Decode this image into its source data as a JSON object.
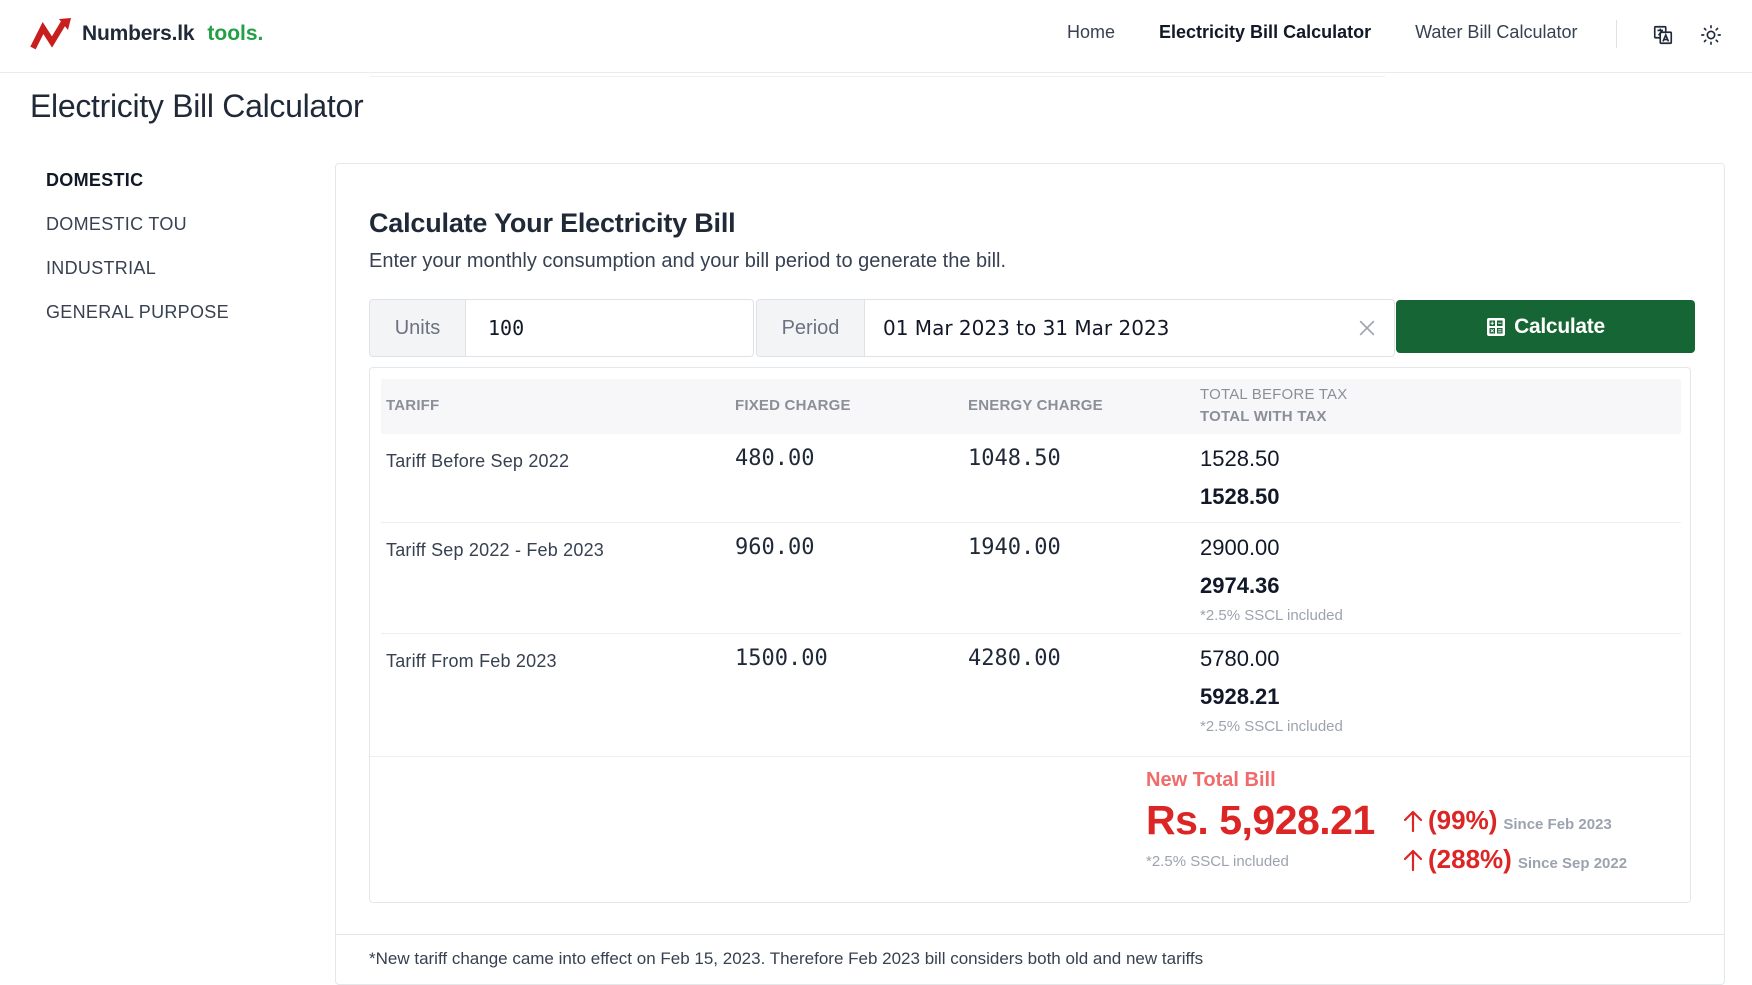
{
  "brand": {
    "name": "Numbers.lk",
    "suffix": "tools."
  },
  "nav": {
    "links": [
      "Home",
      "Electricity Bill Calculator",
      "Water Bill Calculator"
    ],
    "active_index": 1
  },
  "page_title": "Electricity Bill Calculator",
  "sidebar": {
    "items": [
      {
        "label": "DOMESTIC",
        "active": true
      },
      {
        "label": "DOMESTIC TOU",
        "active": false
      },
      {
        "label": "INDUSTRIAL",
        "active": false
      },
      {
        "label": "GENERAL PURPOSE",
        "active": false
      }
    ]
  },
  "card": {
    "title": "Calculate Your Electricity Bill",
    "subtitle": "Enter your monthly consumption and your bill period to generate the bill."
  },
  "form": {
    "units_label": "Units",
    "units_value": "100",
    "period_label": "Period",
    "period_value": "01 Mar 2023 to 31 Mar 2023",
    "calculate_label": "Calculate"
  },
  "table": {
    "headers": {
      "tariff": "TARIFF",
      "fixed": "FIXED CHARGE",
      "energy": "ENERGY CHARGE",
      "total_before": "TOTAL BEFORE TAX",
      "total_with": "TOTAL WITH TAX"
    },
    "rows": [
      {
        "tariff": "Tariff Before Sep 2022",
        "fixed": "480.00",
        "energy": "1048.50",
        "total_before": "1528.50",
        "total_with": "1528.50",
        "note": ""
      },
      {
        "tariff": "Tariff Sep 2022 - Feb 2023",
        "fixed": "960.00",
        "energy": "1940.00",
        "total_before": "2900.00",
        "total_with": "2974.36",
        "note": "*2.5% SSCL included"
      },
      {
        "tariff": "Tariff From Feb 2023",
        "fixed": "1500.00",
        "energy": "4280.00",
        "total_before": "5780.00",
        "total_with": "5928.21",
        "note": "*2.5% SSCL included"
      }
    ]
  },
  "summary": {
    "label": "New Total Bill",
    "value": "Rs. 5,928.21",
    "note": "*2.5% SSCL included",
    "changes": [
      {
        "pct": "(99%)",
        "since": "Since Feb 2023"
      },
      {
        "pct": "(288%)",
        "since": "Since Sep 2022"
      }
    ]
  },
  "footnote": "*New tariff change came into effect on Feb 15, 2023. Therefore Feb 2023 bill considers both old and new tariffs",
  "colors": {
    "brand_green": "#22a045",
    "button_green": "#166534",
    "alert_red": "#dc2626",
    "label_red": "#f06b6b"
  },
  "icons": [
    "logo-icon",
    "translate-icon",
    "sun-icon",
    "close-icon",
    "calculator-icon",
    "arrow-up-icon"
  ]
}
